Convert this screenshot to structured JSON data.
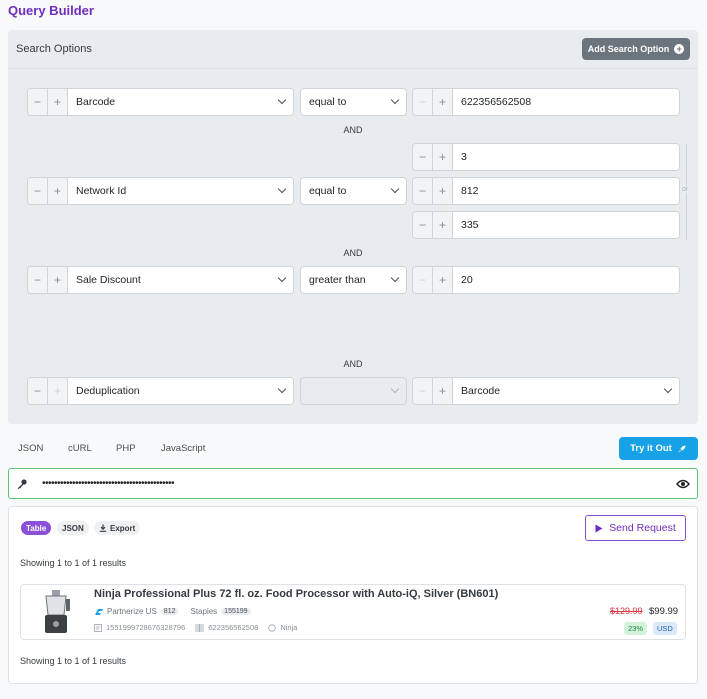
{
  "page": {
    "title": "Query Builder"
  },
  "search": {
    "title": "Search Options",
    "add_button": "Add Search Option",
    "and_label": "AND",
    "or_label": "or",
    "rows": {
      "barcode": {
        "field": "Barcode",
        "operator": "equal to",
        "value": "622356562508"
      },
      "network": {
        "field": "Network Id",
        "operator": "equal to",
        "values": [
          "3",
          "812",
          "335"
        ]
      },
      "discount": {
        "field": "Sale Discount",
        "operator": "greater than",
        "value": "20"
      },
      "dedup": {
        "field": "Deduplication",
        "operator": "",
        "value": "Barcode"
      }
    }
  },
  "code_tabs": [
    "JSON",
    "cURL",
    "PHP",
    "JavaScript"
  ],
  "try_button": "Try it Out",
  "api_key": {
    "masked": "••••••••••••••••••••••••••••••••••••••••••••"
  },
  "results": {
    "view_tabs": {
      "table": "Table",
      "json": "JSON",
      "export": "Export"
    },
    "send_button": "Send Request",
    "showing_top": "Showing 1 to 1 of 1 results",
    "showing_bottom": "Showing 1 to 1 of 1 results",
    "item": {
      "title": "Ninja Professional Plus 72 fl. oz. Food Processor with Auto-iQ, Silver (BN601)",
      "network": "Partnerize US",
      "network_id": "812",
      "merchant": "Staples",
      "merchant_id": "155199",
      "product_id": "1551999728676328796",
      "barcode": "622356562508",
      "brand": "Ninja",
      "old_price": "$129.99",
      "price": "$99.99",
      "discount": "23%",
      "currency": "USD"
    }
  },
  "colors": {
    "brand": "#6f2dbd",
    "accent": "#17a2e8",
    "success": "#5cc97a",
    "strike": "#dc3545"
  }
}
